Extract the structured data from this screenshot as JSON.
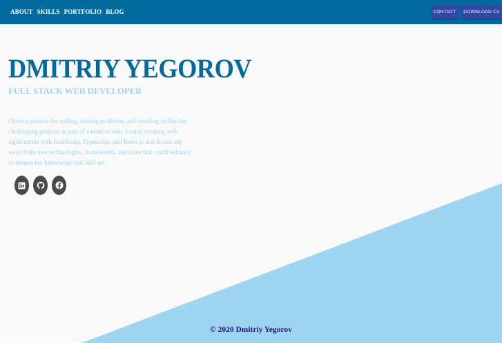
{
  "colors": {
    "header": "#036a9e",
    "accent_light": "#9cd5f0",
    "button": "#3446a8",
    "background": "#f9f9f9",
    "footer_text": "#2d1070",
    "social_bg": "#4a4a4a"
  },
  "nav": {
    "items": [
      "ABOUT",
      "SKILLS",
      "PORTFOLIO",
      "BLOG"
    ]
  },
  "actions": {
    "contact_label": "CONTACT",
    "download_label": "DOWNLOAD CV"
  },
  "hero": {
    "name": "DMITRIY YEGOROV",
    "role": "FULL STACK WEB DEVELOPER",
    "bio": "I have a passion for coding, solving problems, and working on fun but challenging projects as part of a team or solo. I enjoy creating web applications with JavaScript, Typescript, and React.js and do not shy away from new technologies, frameworks, and tools that could enhance or deepen my knowledge and skill set."
  },
  "socials": [
    {
      "icon": "linkedin-icon"
    },
    {
      "icon": "github-icon"
    },
    {
      "icon": "facebook-icon"
    }
  ],
  "footer": {
    "copyright": "© 2020 Dmitriy Yegorov"
  }
}
